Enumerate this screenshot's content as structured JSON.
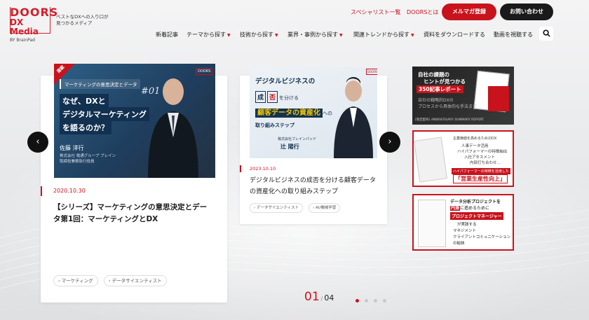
{
  "brand": {
    "logo_line1": "DOORS",
    "logo_line2": "DX Media",
    "logo_line3": "BY BrainPad",
    "tagline_1": "ベストなDXへの入り口が",
    "tagline_2": "見つかるメディア"
  },
  "header": {
    "link_specialists": "スペシャリスト一覧",
    "link_about": "DOORSとは",
    "btn_newsletter": "メルマガ登録",
    "btn_contact": "お問い合わせ"
  },
  "nav": {
    "items": [
      {
        "label": "新着記事",
        "has_caret": false
      },
      {
        "label": "テーマから探す",
        "has_caret": true
      },
      {
        "label": "技術から探す",
        "has_caret": true
      },
      {
        "label": "業界・事例から探す",
        "has_caret": true
      },
      {
        "label": "関連トレンドから探す",
        "has_caret": true
      },
      {
        "label": "資料をダウンロードする",
        "has_caret": false
      },
      {
        "label": "動画を視聴する",
        "has_caret": false
      }
    ]
  },
  "slides": {
    "main": {
      "thumb": {
        "badge": "連載",
        "subtitle": "マーケティングの意思決定とデータ",
        "number": "#01",
        "line1": "なぜ、DXと",
        "line2": "デジタルマーケティング",
        "line3": "を語るのか？",
        "person_name": "佐藤 洋行",
        "person_role1": "株式会社 電通グループ ブレイン",
        "person_role2": "取締役兼務執行役員",
        "logo": "DOORS"
      },
      "date": "2020.10.30",
      "title_line1": "【シリーズ】マーケティングの意思決定とデー",
      "title_line2": "タ第1回：マーケティングとDX",
      "tags": [
        "マーケティング",
        "データサイエンティスト"
      ]
    },
    "second": {
      "thumb": {
        "line1": "デジタルビジネスの",
        "box1": "成",
        "box2": "否",
        "line2_suffix": "を分ける",
        "line3": "顧客データの資産化",
        "line3_suffix": "への",
        "line4": "取り組みステップ",
        "company": "株式会社ブレインパッド",
        "person_name": "辻 陽行",
        "logo": "DOORS"
      },
      "date": "2023.10.10",
      "title_line1": "デジタルビジネスの成否を分ける顧客データ",
      "title_line2": "の資産化への取り組みステップ",
      "tags": [
        "データサイエンティスト",
        "AI/機械学習"
      ]
    }
  },
  "banners": {
    "b1": {
      "line1": "自社の課題の",
      "line2": "ヒントが見つかる",
      "line3": "350記事レポート",
      "line4": "自社の戦略的DXの",
      "line5": "プロセスから具体的な手法まで",
      "line6": "[限定配布] ANNIVERSARY SUMMARY REPORT"
    },
    "b2": {
      "line1": "企業価値を高めるためのDX",
      "line2": "人事データ活用",
      "line3": "ハイパフォーマーの特徴抽出",
      "line4": "入社アセスメント",
      "line5": "内部打ち合わせ...",
      "line6": "ハイパフォーマーの特徴を活用した",
      "line7": "「営業生産性向上」"
    },
    "b3": {
      "line1": "データ分析プロジェクトを",
      "line2_pre": "",
      "line2_b": "円滑",
      "line2_post": "に進めるために",
      "line3": "プロジェクトマネージャー",
      "line4": "が実践する",
      "line5": "マネジメント",
      "line6": "クライアントコミュニケーション",
      "line7": "の秘訣"
    }
  },
  "pager": {
    "current": "01",
    "separator": "/",
    "total": "04",
    "active_index": 0,
    "dots": 4
  },
  "colors": {
    "accent": "#c8131c",
    "dark": "#1a1a1a",
    "navy": "#133350"
  }
}
